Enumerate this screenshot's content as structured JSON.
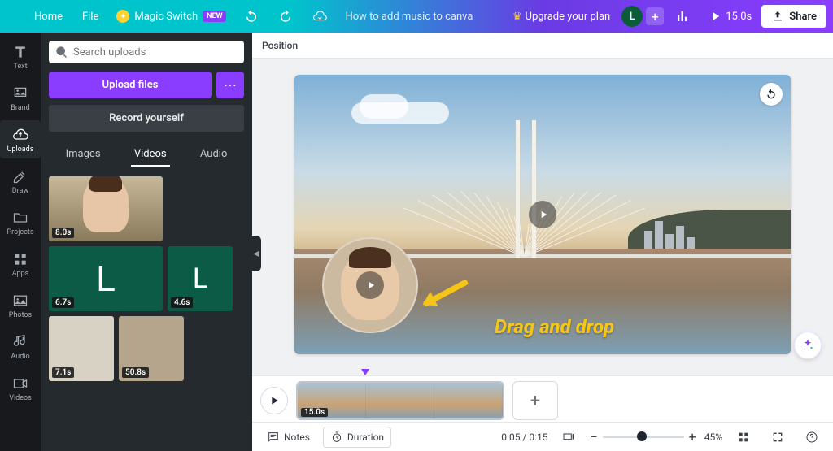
{
  "topbar": {
    "home": "Home",
    "file": "File",
    "magic_switch": "Magic Switch",
    "new_badge": "NEW",
    "doc_title": "How to add music to canva",
    "upgrade": "Upgrade your plan",
    "avatar_initial": "L",
    "duration": "15.0s",
    "share": "Share"
  },
  "rail": {
    "items": [
      {
        "label": "Text",
        "icon": "text"
      },
      {
        "label": "Brand",
        "icon": "brand"
      },
      {
        "label": "Uploads",
        "icon": "uploads",
        "active": true
      },
      {
        "label": "Draw",
        "icon": "draw"
      },
      {
        "label": "Projects",
        "icon": "projects"
      },
      {
        "label": "Apps",
        "icon": "apps"
      },
      {
        "label": "Photos",
        "icon": "photos"
      },
      {
        "label": "Audio",
        "icon": "audio"
      },
      {
        "label": "Videos",
        "icon": "videos"
      }
    ]
  },
  "panel": {
    "search_placeholder": "Search uploads",
    "upload_button": "Upload files",
    "record_button": "Record yourself",
    "tabs": [
      "Images",
      "Videos",
      "Audio"
    ],
    "active_tab": "Videos",
    "videos": [
      {
        "dur": "8.0s",
        "kind": "person",
        "w": "big"
      },
      {
        "dur": "6.7s",
        "kind": "green",
        "w": "big",
        "letter": "L"
      },
      {
        "dur": "4.6s",
        "kind": "green",
        "w": "sm",
        "letter": "L"
      },
      {
        "dur": "7.1s",
        "kind": "room",
        "w": "sm"
      },
      {
        "dur": "50.8s",
        "kind": "room2",
        "w": "sm"
      }
    ]
  },
  "canvas": {
    "position_label": "Position",
    "annotation": "Drag and drop"
  },
  "timeline": {
    "clip_duration": "15.0s"
  },
  "bottombar": {
    "notes": "Notes",
    "duration": "Duration",
    "time": "0:05 / 0:15",
    "zoom": "45%"
  }
}
